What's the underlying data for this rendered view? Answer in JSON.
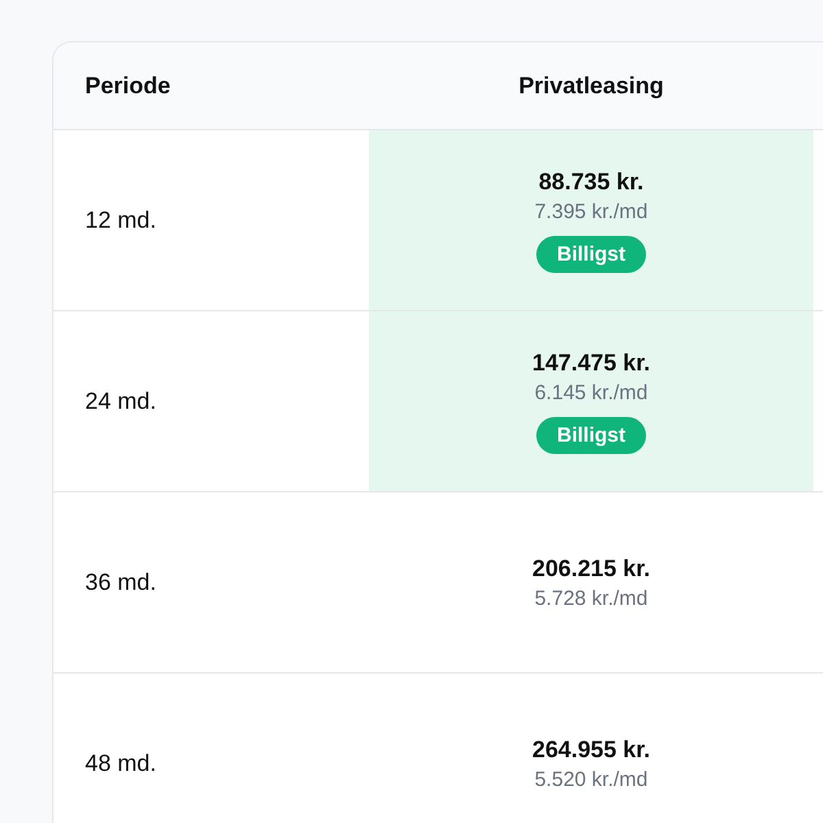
{
  "table": {
    "columns": [
      "Periode",
      "Privatleasing"
    ],
    "rows": [
      {
        "period": "12 md.",
        "price": "88.735 kr.",
        "monthly": "7.395 kr./md",
        "highlighted": true,
        "badge": "Billigst"
      },
      {
        "period": "24 md.",
        "price": "147.475 kr.",
        "monthly": "6.145 kr./md",
        "highlighted": true,
        "badge": "Billigst"
      },
      {
        "period": "36 md.",
        "price": "206.215 kr.",
        "monthly": "5.728 kr./md",
        "highlighted": false
      },
      {
        "period": "48 md.",
        "price": "264.955 kr.",
        "monthly": "5.520 kr./md",
        "highlighted": false
      }
    ]
  }
}
